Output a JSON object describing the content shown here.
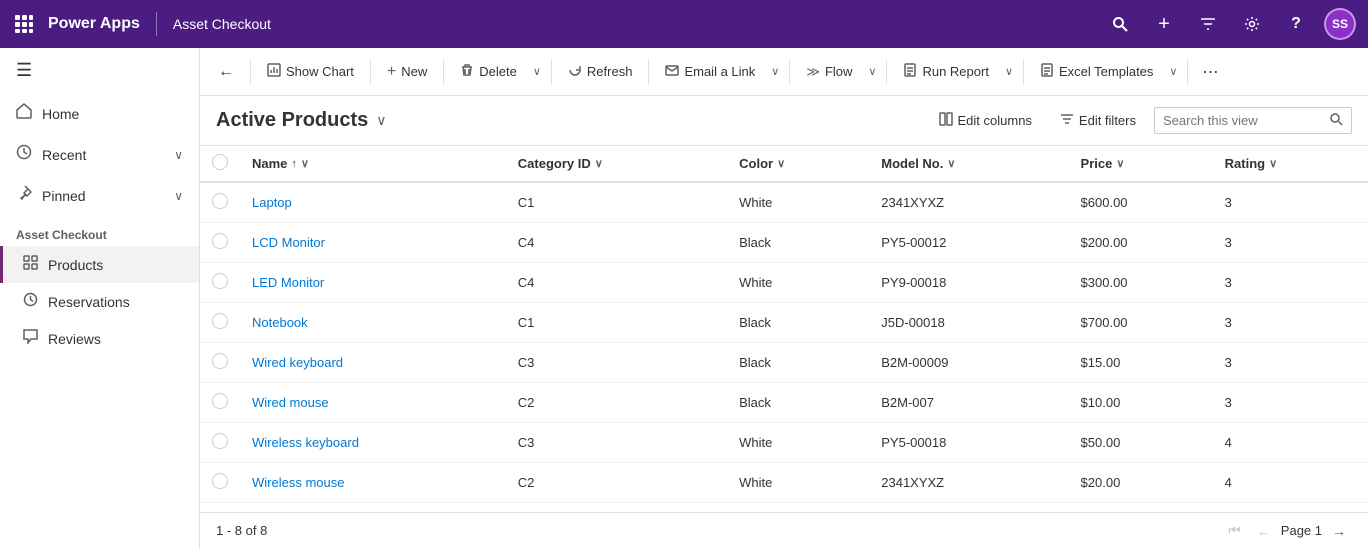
{
  "topnav": {
    "app_name": "Power Apps",
    "divider": "|",
    "page_title": "Asset Checkout",
    "avatar_initials": "SS",
    "icons": {
      "search": "🔍",
      "add": "+",
      "filter": "⚗",
      "settings": "⚙",
      "help": "?"
    }
  },
  "sidebar": {
    "toggle_icon": "☰",
    "nav_items": [
      {
        "label": "Home",
        "icon": "🏠"
      },
      {
        "label": "Recent",
        "icon": "🕐",
        "chevron": "∨"
      },
      {
        "label": "Pinned",
        "icon": "📌",
        "chevron": "∨"
      }
    ],
    "section_label": "Asset Checkout",
    "sub_items": [
      {
        "label": "Products",
        "icon": "▣",
        "active": true
      },
      {
        "label": "Reservations",
        "icon": "◎",
        "active": false
      },
      {
        "label": "Reviews",
        "icon": "💬",
        "active": false
      }
    ]
  },
  "toolbar": {
    "back_icon": "←",
    "show_chart_label": "Show Chart",
    "show_chart_icon": "📊",
    "new_label": "New",
    "new_icon": "+",
    "delete_label": "Delete",
    "delete_icon": "🗑",
    "refresh_label": "Refresh",
    "refresh_icon": "↺",
    "email_link_label": "Email a Link",
    "email_link_icon": "📧",
    "flow_label": "Flow",
    "flow_icon": "≫",
    "run_report_label": "Run Report",
    "run_report_icon": "📋",
    "excel_templates_label": "Excel Templates",
    "excel_templates_icon": "📑",
    "more_icon": "⋯"
  },
  "view": {
    "title": "Active Products",
    "title_chevron": "∨",
    "edit_columns_label": "Edit columns",
    "edit_columns_icon": "⊞",
    "edit_filters_label": "Edit filters",
    "edit_filters_icon": "⚗",
    "search_placeholder": "Search this view",
    "search_icon": "🔍"
  },
  "table": {
    "columns": [
      {
        "key": "checkbox",
        "label": ""
      },
      {
        "key": "name",
        "label": "Name",
        "sortable": true,
        "sort": "asc"
      },
      {
        "key": "category_id",
        "label": "Category ID",
        "filterable": true
      },
      {
        "key": "color",
        "label": "Color",
        "filterable": true
      },
      {
        "key": "model_no",
        "label": "Model No.",
        "filterable": true
      },
      {
        "key": "price",
        "label": "Price",
        "filterable": true
      },
      {
        "key": "rating",
        "label": "Rating",
        "filterable": true
      }
    ],
    "rows": [
      {
        "name": "Laptop",
        "category_id": "C1",
        "color": "White",
        "model_no": "2341XYXZ",
        "price": "$600.00",
        "rating": "3"
      },
      {
        "name": "LCD Monitor",
        "category_id": "C4",
        "color": "Black",
        "model_no": "PY5-00012",
        "price": "$200.00",
        "rating": "3"
      },
      {
        "name": "LED Monitor",
        "category_id": "C4",
        "color": "White",
        "model_no": "PY9-00018",
        "price": "$300.00",
        "rating": "3"
      },
      {
        "name": "Notebook",
        "category_id": "C1",
        "color": "Black",
        "model_no": "J5D-00018",
        "price": "$700.00",
        "rating": "3"
      },
      {
        "name": "Wired keyboard",
        "category_id": "C3",
        "color": "Black",
        "model_no": "B2M-00009",
        "price": "$15.00",
        "rating": "3"
      },
      {
        "name": "Wired mouse",
        "category_id": "C2",
        "color": "Black",
        "model_no": "B2M-007",
        "price": "$10.00",
        "rating": "3"
      },
      {
        "name": "Wireless keyboard",
        "category_id": "C3",
        "color": "White",
        "model_no": "PY5-00018",
        "price": "$50.00",
        "rating": "4"
      },
      {
        "name": "Wireless mouse",
        "category_id": "C2",
        "color": "White",
        "model_no": "2341XYXZ",
        "price": "$20.00",
        "rating": "4"
      }
    ]
  },
  "footer": {
    "record_count": "1 - 8 of 8",
    "page_label": "Page 1"
  }
}
